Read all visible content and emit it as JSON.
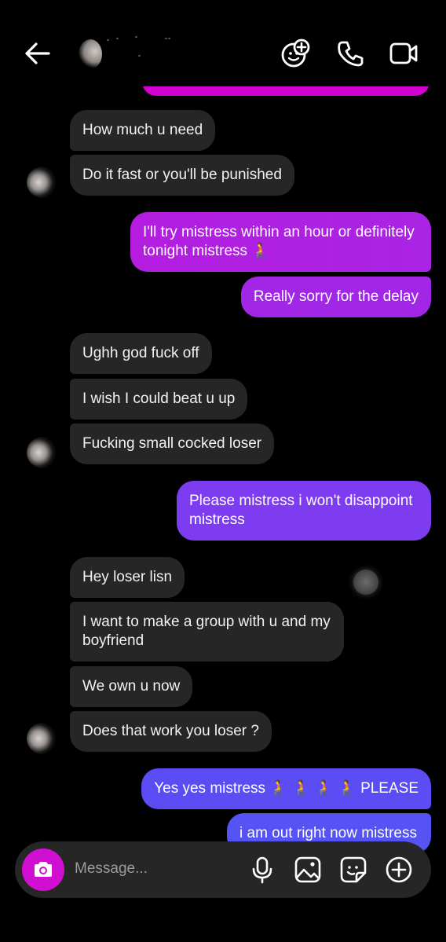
{
  "header": {
    "back_icon": "arrow-left-icon",
    "icons": [
      "video-effects-icon",
      "phone-icon",
      "video-camera-icon"
    ]
  },
  "messages": [
    {
      "side": "received",
      "text": "How much u need"
    },
    {
      "side": "received",
      "text": "Do it fast or you'll be punished"
    },
    {
      "side": "sent",
      "text": "I'll try mistress within an hour or definitely tonight mistress 🧎",
      "color": "#b11ee0"
    },
    {
      "side": "sent",
      "text": "Really sorry for the delay",
      "color": "#a126e6"
    },
    {
      "side": "received",
      "text": "Ughh god fuck off"
    },
    {
      "side": "received",
      "text": "I wish I could beat u up"
    },
    {
      "side": "received",
      "text": "Fucking small cocked loser"
    },
    {
      "side": "sent",
      "text": "Please mistress i won't disappoint mistress",
      "color": "#7e3cf0"
    },
    {
      "side": "received",
      "text": "Hey loser lisn"
    },
    {
      "side": "received",
      "text": "I want to make a group with u and my boyfriend"
    },
    {
      "side": "received",
      "text": "We own u now"
    },
    {
      "side": "received",
      "text": "Does that work you loser ?"
    },
    {
      "side": "sent",
      "text": "Yes yes mistress 🧎 🧎 🧎 🧎 PLEASE",
      "color": "#5b4cf3"
    },
    {
      "side": "sent",
      "text": "i am out right now mistress",
      "color": "#5553f4"
    }
  ],
  "composer": {
    "placeholder": "Message...",
    "camera_icon": "camera-icon",
    "icons": [
      "microphone-icon",
      "gallery-icon",
      "sticker-icon",
      "add-icon"
    ]
  },
  "colors": {
    "background": "#000000",
    "received_bubble": "#262626",
    "top_sent_bubble": "#d200d0",
    "camera_button": "#d10fd2"
  }
}
